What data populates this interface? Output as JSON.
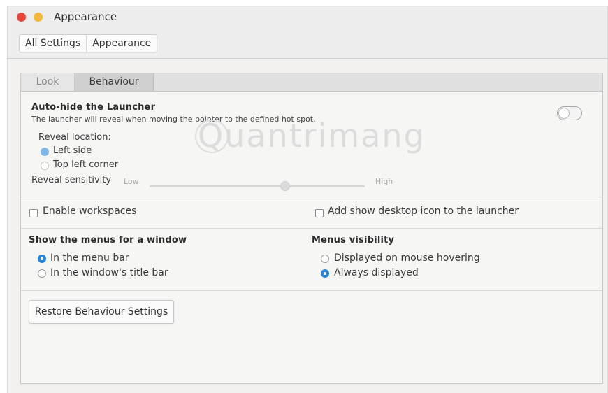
{
  "window": {
    "title": "Appearance",
    "breadcrumbs": [
      "All Settings",
      "Appearance"
    ]
  },
  "tabs": [
    "Look",
    "Behaviour"
  ],
  "active_tab": "Behaviour",
  "autohide": {
    "title": "Auto-hide the Launcher",
    "description": "The launcher will reveal when moving the pointer to the defined hot spot.",
    "enabled": false,
    "reveal_location_label": "Reveal location:",
    "options": [
      "Left side",
      "Top left corner"
    ],
    "selected": "Left side",
    "sensitivity_label": "Reveal sensitivity",
    "low_label": "Low",
    "high_label": "High",
    "sensitivity_value": 0.63
  },
  "workspaces": {
    "enable_label": "Enable workspaces",
    "enable_checked": false,
    "desktop_icon_label": "Add show desktop icon to the launcher",
    "desktop_icon_checked": false
  },
  "menus": {
    "title": "Show the menus for a window",
    "options": [
      "In the menu bar",
      "In the window's title bar"
    ],
    "selected": "In the menu bar"
  },
  "visibility": {
    "title": "Menus visibility",
    "options": [
      "Displayed on mouse hovering",
      "Always displayed"
    ],
    "selected": "Always displayed"
  },
  "restore_button": "Restore Behaviour Settings",
  "watermark": "Quantrimang",
  "colors": {
    "close": "#e8453c",
    "minimize": "#f3b73a",
    "accent": "#2a84d8"
  }
}
